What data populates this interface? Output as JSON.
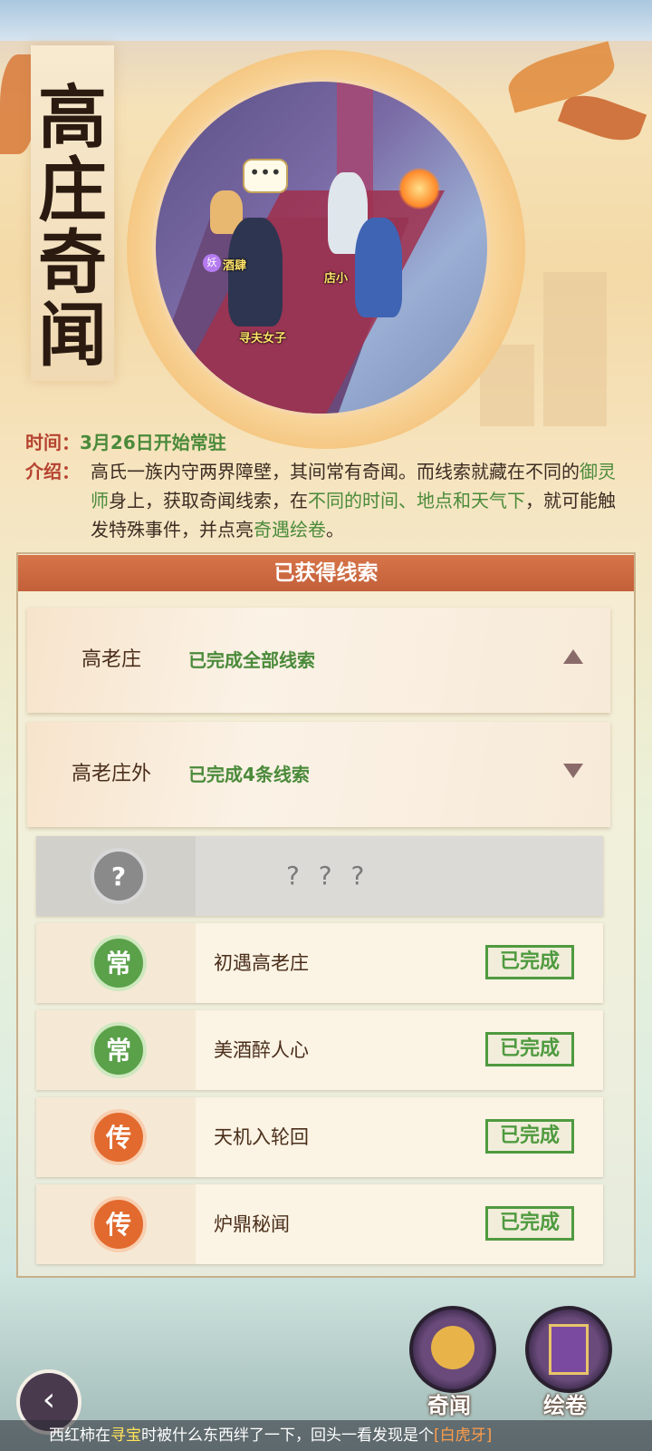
{
  "title_chars": [
    "高",
    "庄",
    "奇",
    "闻"
  ],
  "portrait": {
    "bubble_text": "•••",
    "badge": "妖",
    "npc_labels": [
      "酒肆",
      "店小",
      "寻夫女子"
    ]
  },
  "info": {
    "time_label": "时间：",
    "time_value": "3月26日开始常驻",
    "intro_label": "介绍：",
    "intro_parts": {
      "p1": "高氏一族内守两界障壁，其间常有奇闻。而线索就藏在不同的",
      "p2": "御灵师",
      "p3": "身上，获取奇闻线索，在",
      "p4": "不同的时间、地点和天气下",
      "p5": "，就可能触发特殊事件，并点亮",
      "p6": "奇遇绘卷",
      "p7": "。"
    }
  },
  "panel": {
    "header": "已获得线索",
    "regions": [
      {
        "name": "高老庄",
        "status": "已完成全部线索",
        "expanded": true
      },
      {
        "name": "高老庄外",
        "status": "已完成4条线索",
        "expanded": false
      }
    ],
    "clues": [
      {
        "badge": "?",
        "title": "? ? ?",
        "status": "",
        "unknown": true
      },
      {
        "badge": "常",
        "title": "初遇高老庄",
        "status": "已完成"
      },
      {
        "badge": "常",
        "title": "美酒醉人心",
        "status": "已完成"
      },
      {
        "badge": "传",
        "title": "天机入轮回",
        "status": "已完成"
      },
      {
        "badge": "传",
        "title": "炉鼎秘闻",
        "status": "已完成"
      }
    ]
  },
  "bottom": {
    "back_glyph": "‹",
    "btn1_label": "奇闻",
    "btn2_label": "绘卷"
  },
  "ticker": {
    "part1": "西红柿在",
    "part2": "寻宝",
    "part3": "时被什么东西绊了一下，回头一看发现是个",
    "part4": "[白虎牙]"
  },
  "colors": {
    "accent_green": "#4a8a3a",
    "header_orange": "#c3603a",
    "badge_green": "#5aa14a",
    "badge_orange": "#e26a2e"
  }
}
